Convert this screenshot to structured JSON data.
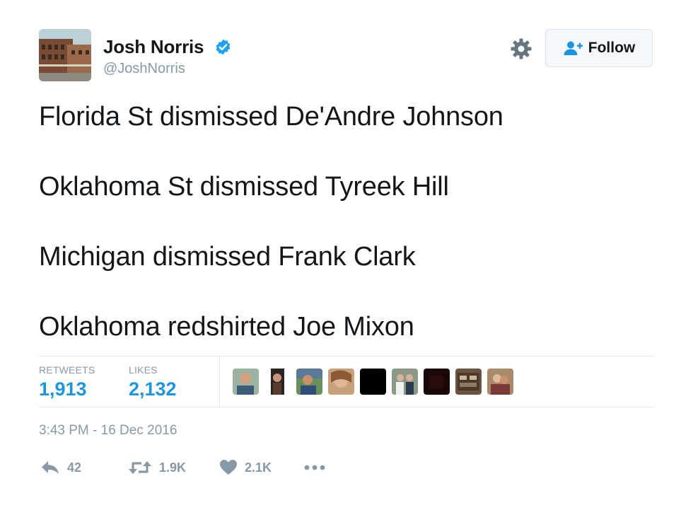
{
  "user": {
    "name": "Josh Norris",
    "handle": "@JoshNorris"
  },
  "follow_button": {
    "label": "Follow"
  },
  "tweet": {
    "lines": [
      "Florida St dismissed De'Andre Johnson",
      "Oklahoma St dismissed Tyreek Hill",
      "Michigan dismissed Frank Clark",
      "Oklahoma redshirted Joe Mixon"
    ]
  },
  "stats": {
    "retweets_label": "RETWEETS",
    "retweets_value": "1,913",
    "likes_label": "LIKES",
    "likes_value": "2,132"
  },
  "timestamp": "3:43 PM - 16 Dec 2016",
  "actions": {
    "reply_count": "42",
    "retweet_count": "1.9K",
    "like_count": "2.1K"
  },
  "colors": {
    "accent": "#1b95e0",
    "muted": "#8899a6",
    "text": "#14171a",
    "verified": "#1da1f2"
  },
  "icons": [
    "verified-badge-icon",
    "gear-icon",
    "follow-person-icon",
    "reply-icon",
    "retweet-icon",
    "heart-icon",
    "more-icon"
  ]
}
